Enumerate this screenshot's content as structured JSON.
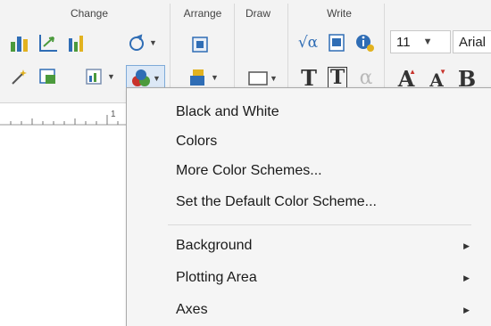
{
  "ribbon": {
    "groups": {
      "change": "Change",
      "arrange": "Arrange",
      "draw": "Draw",
      "write": "Write"
    },
    "font_size": "11",
    "font_name": "Arial",
    "letters": {
      "sqrt": "√α",
      "t_plain": "T",
      "t_boxed": "T",
      "alpha": "α",
      "grow": "A",
      "shrink": "A",
      "bold": "B"
    },
    "ruler_mark": "1"
  },
  "menu": {
    "items": [
      {
        "label": "Black and White"
      },
      {
        "label": "Colors"
      },
      {
        "label": "More Color Schemes..."
      },
      {
        "label": "Set the Default Color Scheme..."
      }
    ],
    "submenus": [
      {
        "label": "Background",
        "arrow": "▶"
      },
      {
        "label": "Plotting Area",
        "arrow": "▶"
      },
      {
        "label": "Axes",
        "arrow": "▶"
      }
    ]
  },
  "colors": {
    "accent_blue": "#2f6db5",
    "icon_green": "#4b9a3c",
    "icon_red": "#c8322b",
    "icon_yellow": "#e2b21f"
  }
}
